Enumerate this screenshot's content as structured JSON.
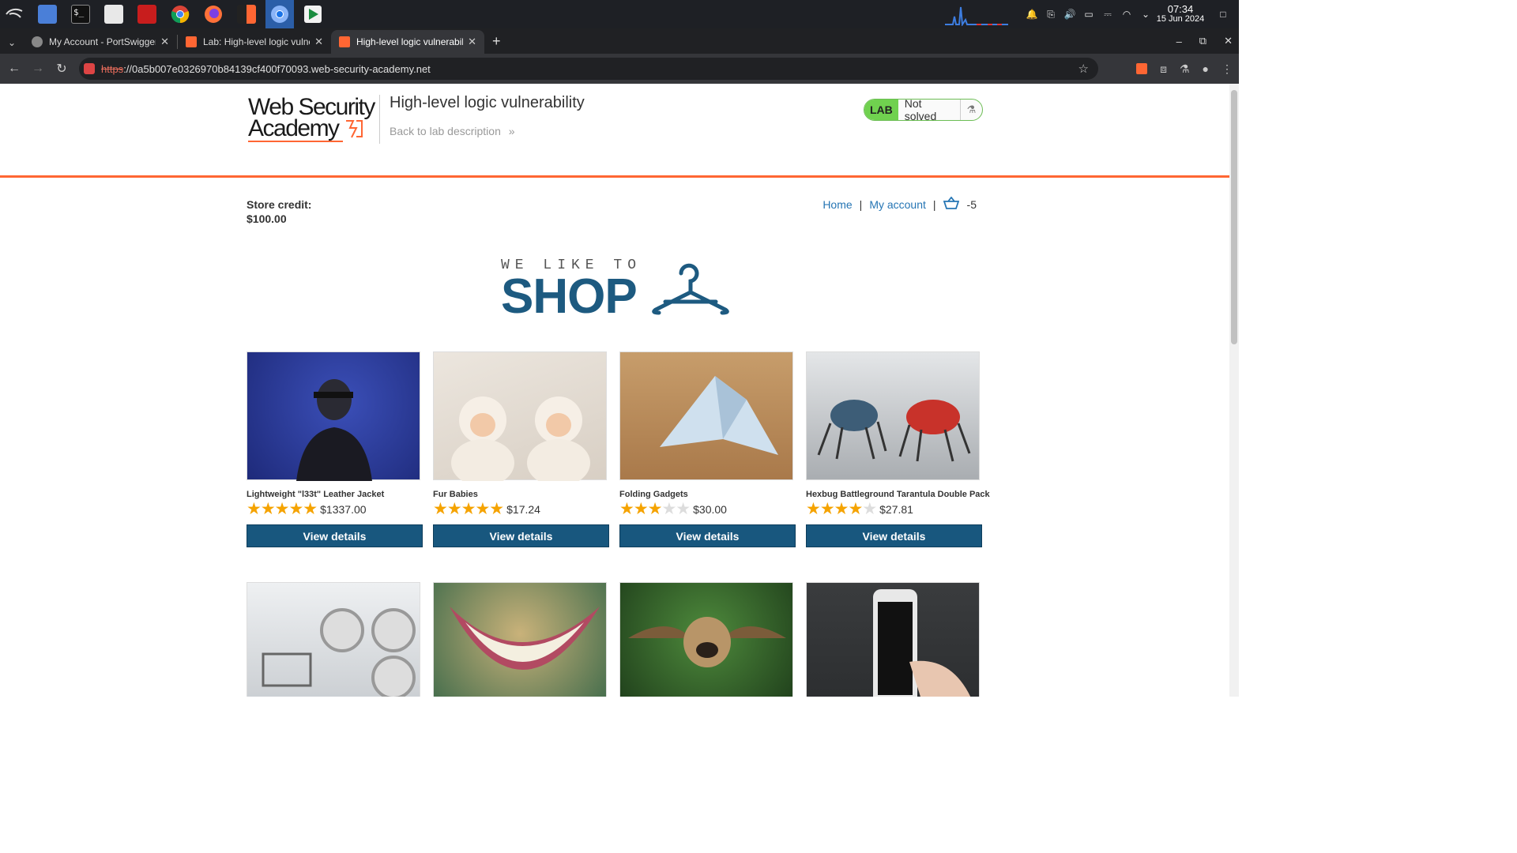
{
  "taskbar": {
    "apps": [
      "kali-menu",
      "desktop",
      "terminal",
      "files",
      "text-editor",
      "chrome",
      "firefox",
      "burp-suite",
      "chromium",
      "app"
    ],
    "clock_time": "07:34",
    "clock_date": "15 Jun 2024"
  },
  "browser": {
    "tabs": [
      {
        "title": "My Account - PortSwigger",
        "active": false
      },
      {
        "title": "Lab: High-level logic vulner",
        "active": false
      },
      {
        "title": "High-level logic vulnerabili",
        "active": true
      }
    ],
    "url_protocol": "https",
    "url_rest": "://0a5b007e0326970b84139cf400f70093.web-security-academy.net"
  },
  "lab_header": {
    "logo_line1": "Web Security",
    "logo_line2": "Academy",
    "title": "High-level logic vulnerability",
    "back_link": "Back to lab description",
    "badge": "LAB",
    "status": "Not solved"
  },
  "account": {
    "credit_label": "Store credit:",
    "credit_value": "$100.00"
  },
  "nav": {
    "home": "Home",
    "my_account": "My account",
    "cart_count": "-5"
  },
  "banner": {
    "small": "WE LIKE TO",
    "big": "SHOP"
  },
  "products": [
    {
      "name": "Lightweight \"l33t\" Leather Jacket",
      "rating": 5,
      "price": "$1337.00",
      "button": "View details"
    },
    {
      "name": "Fur Babies",
      "rating": 5,
      "price": "$17.24",
      "button": "View details"
    },
    {
      "name": "Folding Gadgets",
      "rating": 3,
      "price": "$30.00",
      "button": "View details"
    },
    {
      "name": "Hexbug Battleground Tarantula Double Pack",
      "rating": 4,
      "price": "$27.81",
      "button": "View details"
    }
  ],
  "colors": {
    "accent_orange": "#ff6633",
    "button_blue": "#18577e",
    "link_blue": "#2575b4",
    "star": "#f5a300"
  }
}
